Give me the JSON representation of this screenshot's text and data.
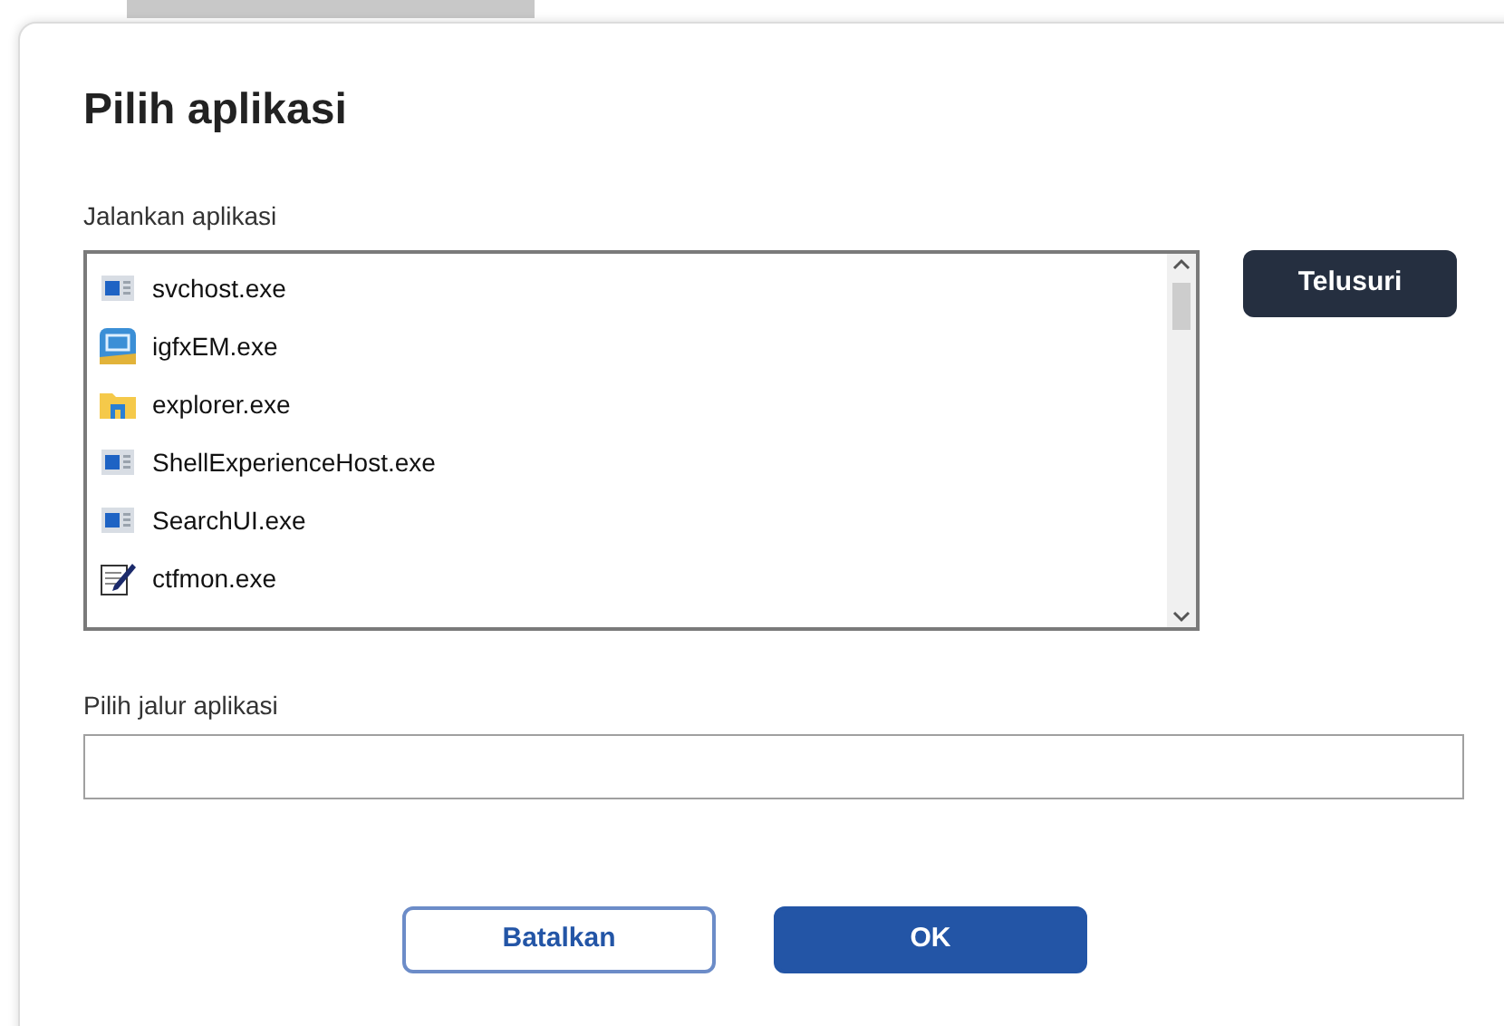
{
  "dialog": {
    "title": "Pilih aplikasi",
    "run_label": "Jalankan aplikasi",
    "apps": [
      {
        "name": "svchost.exe",
        "kind": "window"
      },
      {
        "name": "igfxEM.exe",
        "kind": "monitor"
      },
      {
        "name": "explorer.exe",
        "kind": "folder"
      },
      {
        "name": "ShellExperienceHost.exe",
        "kind": "window"
      },
      {
        "name": "SearchUI.exe",
        "kind": "window"
      },
      {
        "name": "ctfmon.exe",
        "kind": "pen"
      }
    ],
    "browse_button": "Telusuri",
    "path_label": "Pilih jalur aplikasi",
    "buttons": [
      {
        "label": "Batalkan",
        "kind": "secondary"
      },
      {
        "label": "OK",
        "kind": "primary"
      }
    ]
  }
}
